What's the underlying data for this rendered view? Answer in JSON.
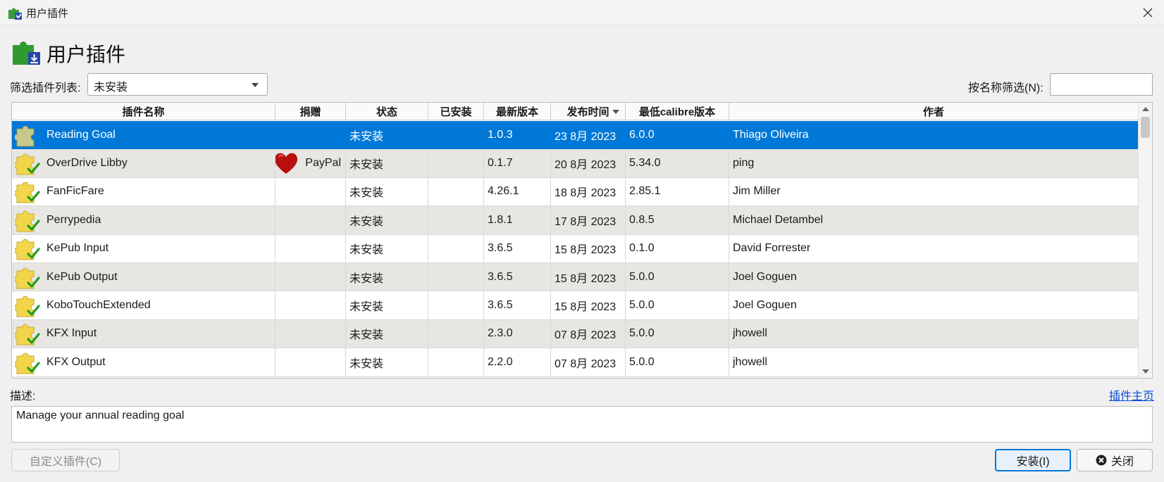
{
  "window": {
    "title": "用户插件"
  },
  "header": {
    "title": "用户插件"
  },
  "filter": {
    "label": "筛选插件列表:",
    "selected": "未安装",
    "name_filter_label": "按名称筛选(N):",
    "name_filter_value": ""
  },
  "table": {
    "columns": [
      "插件名称",
      "捐赠",
      "状态",
      "已安装",
      "最新版本",
      "发布时间",
      "最低calibre版本",
      "作者"
    ],
    "rows": [
      {
        "name": "Reading Goal",
        "donate": "",
        "status": "未安装",
        "installed": "",
        "latest": "1.0.3",
        "released": "23 8月 2023",
        "min_calibre": "6.0.0",
        "author": "Thiago Oliveira"
      },
      {
        "name": "OverDrive Libby",
        "donate": "PayPal",
        "status": "未安装",
        "installed": "",
        "latest": "0.1.7",
        "released": "20 8月 2023",
        "min_calibre": "5.34.0",
        "author": "ping"
      },
      {
        "name": "FanFicFare",
        "donate": "",
        "status": "未安装",
        "installed": "",
        "latest": "4.26.1",
        "released": "18 8月 2023",
        "min_calibre": "2.85.1",
        "author": "Jim Miller"
      },
      {
        "name": "Perrypedia",
        "donate": "",
        "status": "未安装",
        "installed": "",
        "latest": "1.8.1",
        "released": "17 8月 2023",
        "min_calibre": "0.8.5",
        "author": "Michael Detambel"
      },
      {
        "name": "KePub Input",
        "donate": "",
        "status": "未安装",
        "installed": "",
        "latest": "3.6.5",
        "released": "15 8月 2023",
        "min_calibre": "0.1.0",
        "author": "David Forrester"
      },
      {
        "name": "KePub Output",
        "donate": "",
        "status": "未安装",
        "installed": "",
        "latest": "3.6.5",
        "released": "15 8月 2023",
        "min_calibre": "5.0.0",
        "author": "Joel Goguen"
      },
      {
        "name": "KoboTouchExtended",
        "donate": "",
        "status": "未安装",
        "installed": "",
        "latest": "3.6.5",
        "released": "15 8月 2023",
        "min_calibre": "5.0.0",
        "author": "Joel Goguen"
      },
      {
        "name": "KFX Input",
        "donate": "",
        "status": "未安装",
        "installed": "",
        "latest": "2.3.0",
        "released": "07 8月 2023",
        "min_calibre": "5.0.0",
        "author": "jhowell"
      },
      {
        "name": "KFX Output",
        "donate": "",
        "status": "未安装",
        "installed": "",
        "latest": "2.2.0",
        "released": "07 8月 2023",
        "min_calibre": "5.0.0",
        "author": "jhowell"
      }
    ],
    "selected_index": 0,
    "sorted_column": "发布时间"
  },
  "description": {
    "label": "描述:",
    "text": "Manage your annual reading goal",
    "homepage_link": "插件主页"
  },
  "buttons": {
    "customize": "自定义插件(C)",
    "install": "安装(I)",
    "close": "关闭"
  },
  "icons": {
    "plugin": "puzzle-piece-icon",
    "donate": "heart-icon",
    "close": "close-icon"
  },
  "colors": {
    "selection": "#0078d7",
    "link": "#0a4cd6",
    "alt_row": "#e8e6e3"
  }
}
